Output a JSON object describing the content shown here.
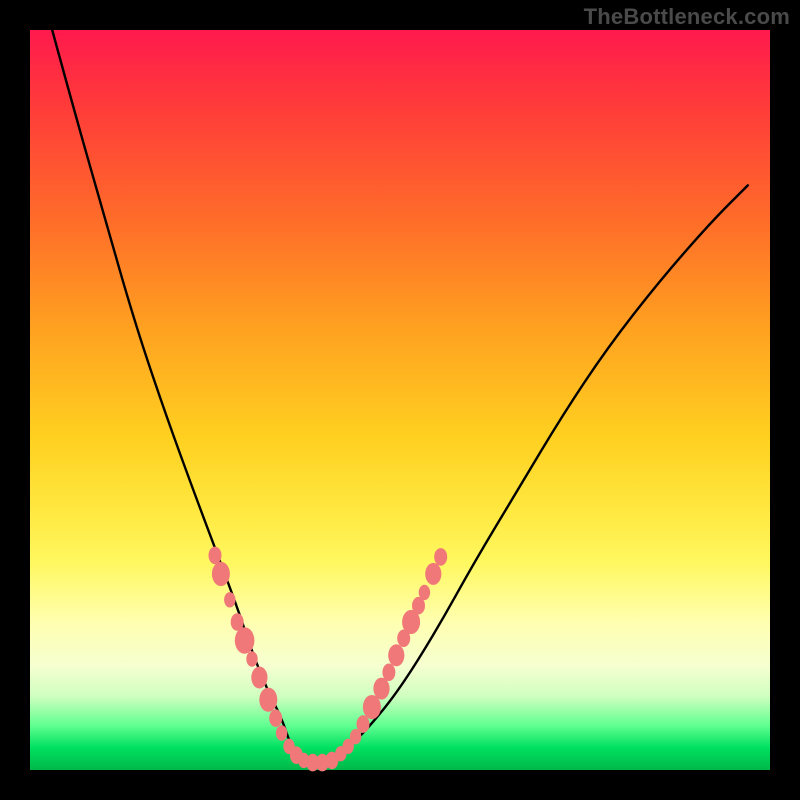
{
  "watermark": "TheBottleneck.com",
  "chart_data": {
    "type": "line",
    "title": "",
    "xlabel": "",
    "ylabel": "",
    "xlim": [
      0,
      100
    ],
    "ylim": [
      0,
      100
    ],
    "grid": false,
    "series": [
      {
        "name": "curve",
        "x": [
          3,
          6,
          10,
          14,
          18,
          22,
          25,
          28,
          30,
          32,
          34,
          35,
          36,
          38,
          40,
          43,
          46,
          50,
          55,
          60,
          66,
          72,
          78,
          85,
          92,
          97
        ],
        "values": [
          100,
          89,
          75,
          61,
          49,
          38,
          30,
          22,
          16,
          11,
          7,
          4,
          2,
          1,
          1,
          3,
          6,
          11,
          19,
          28,
          38,
          48,
          57,
          66,
          74,
          79
        ]
      }
    ],
    "markers": [
      {
        "x": 25.0,
        "y": 29.0,
        "r": 1.6
      },
      {
        "x": 25.8,
        "y": 26.5,
        "r": 2.2
      },
      {
        "x": 27.0,
        "y": 23.0,
        "r": 1.4
      },
      {
        "x": 28.0,
        "y": 20.0,
        "r": 1.6
      },
      {
        "x": 29.0,
        "y": 17.5,
        "r": 2.4
      },
      {
        "x": 30.0,
        "y": 15.0,
        "r": 1.4
      },
      {
        "x": 31.0,
        "y": 12.5,
        "r": 2.0
      },
      {
        "x": 32.2,
        "y": 9.5,
        "r": 2.2
      },
      {
        "x": 33.2,
        "y": 7.0,
        "r": 1.6
      },
      {
        "x": 34.0,
        "y": 5.0,
        "r": 1.4
      },
      {
        "x": 35.0,
        "y": 3.2,
        "r": 1.4
      },
      {
        "x": 36.0,
        "y": 2.0,
        "r": 1.6
      },
      {
        "x": 37.0,
        "y": 1.3,
        "r": 1.4
      },
      {
        "x": 38.2,
        "y": 1.0,
        "r": 1.6
      },
      {
        "x": 39.5,
        "y": 1.0,
        "r": 1.6
      },
      {
        "x": 40.8,
        "y": 1.3,
        "r": 1.6
      },
      {
        "x": 42.0,
        "y": 2.2,
        "r": 1.4
      },
      {
        "x": 43.0,
        "y": 3.2,
        "r": 1.4
      },
      {
        "x": 44.0,
        "y": 4.5,
        "r": 1.4
      },
      {
        "x": 45.0,
        "y": 6.2,
        "r": 1.6
      },
      {
        "x": 46.2,
        "y": 8.5,
        "r": 2.2
      },
      {
        "x": 47.5,
        "y": 11.0,
        "r": 2.0
      },
      {
        "x": 48.5,
        "y": 13.2,
        "r": 1.6
      },
      {
        "x": 49.5,
        "y": 15.5,
        "r": 2.0
      },
      {
        "x": 50.5,
        "y": 17.8,
        "r": 1.6
      },
      {
        "x": 51.5,
        "y": 20.0,
        "r": 2.2
      },
      {
        "x": 52.5,
        "y": 22.2,
        "r": 1.6
      },
      {
        "x": 53.3,
        "y": 24.0,
        "r": 1.4
      },
      {
        "x": 54.5,
        "y": 26.5,
        "r": 2.0
      },
      {
        "x": 55.5,
        "y": 28.8,
        "r": 1.6
      }
    ],
    "marker_color": "#f07878"
  }
}
